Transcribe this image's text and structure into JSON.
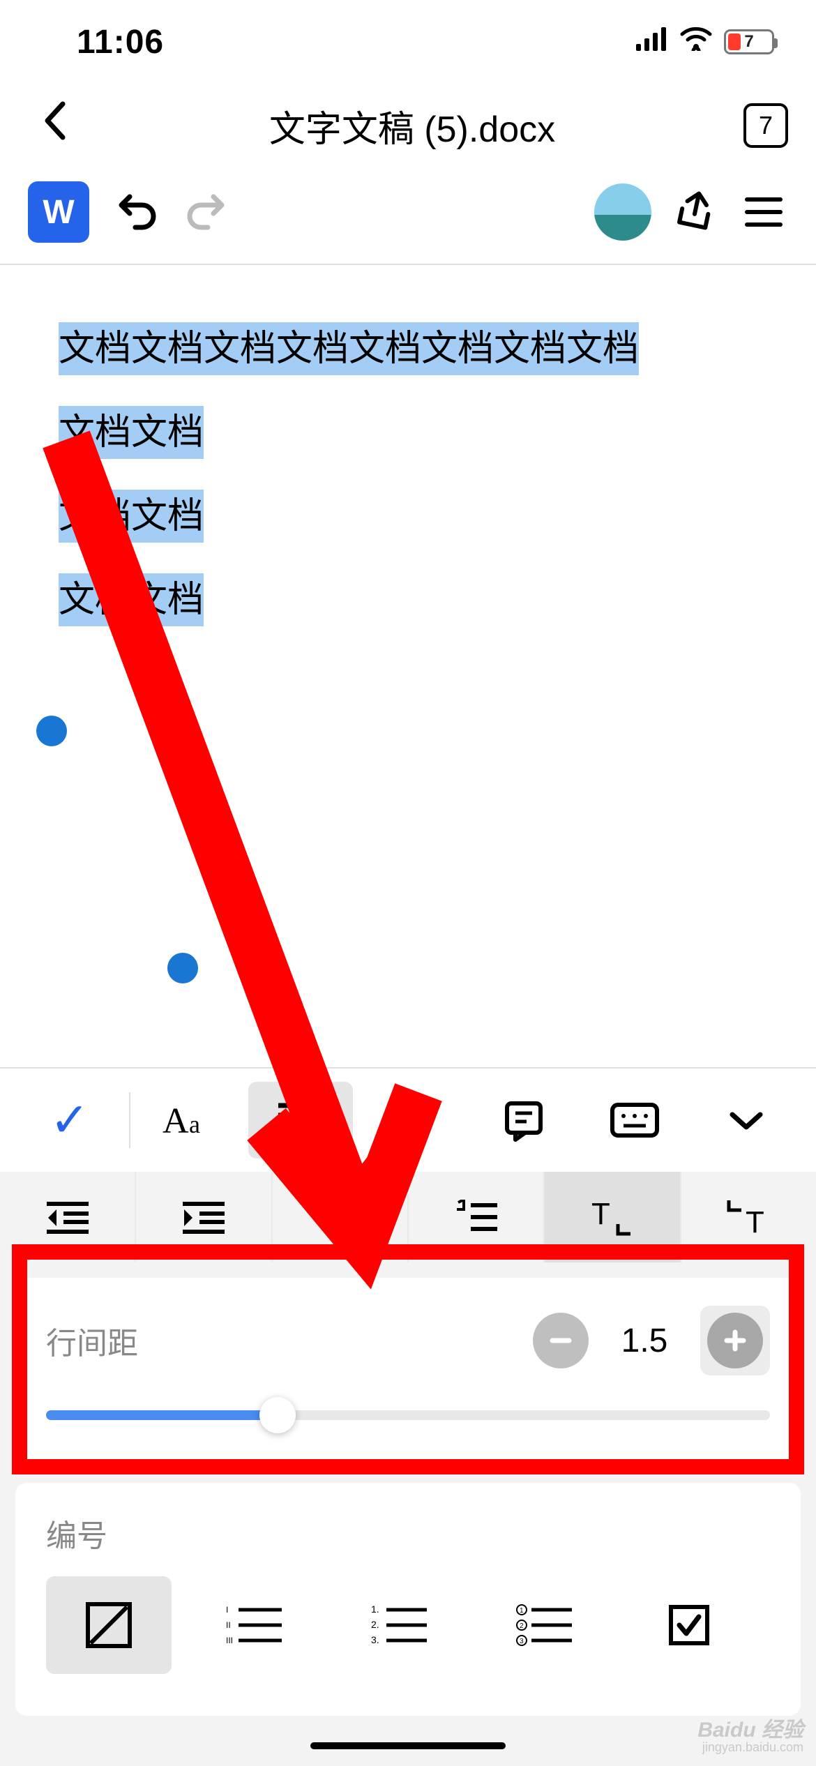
{
  "status": {
    "time": "11:06",
    "battery": "7"
  },
  "header": {
    "title": "文字文稿 (5).docx",
    "tab_count": "7"
  },
  "toolbar": {
    "app_letter": "W"
  },
  "document": {
    "lines": [
      "文档文档文档文档文档文档文档文档",
      "文档文档",
      "文档文档",
      "文档文档"
    ]
  },
  "panel": {
    "line_spacing_label": "行间距",
    "line_spacing_value": "1.5",
    "numbering_label": "编号"
  },
  "watermark": {
    "brand": "Baidu 经验",
    "sub": "jingyan.baidu.com"
  }
}
